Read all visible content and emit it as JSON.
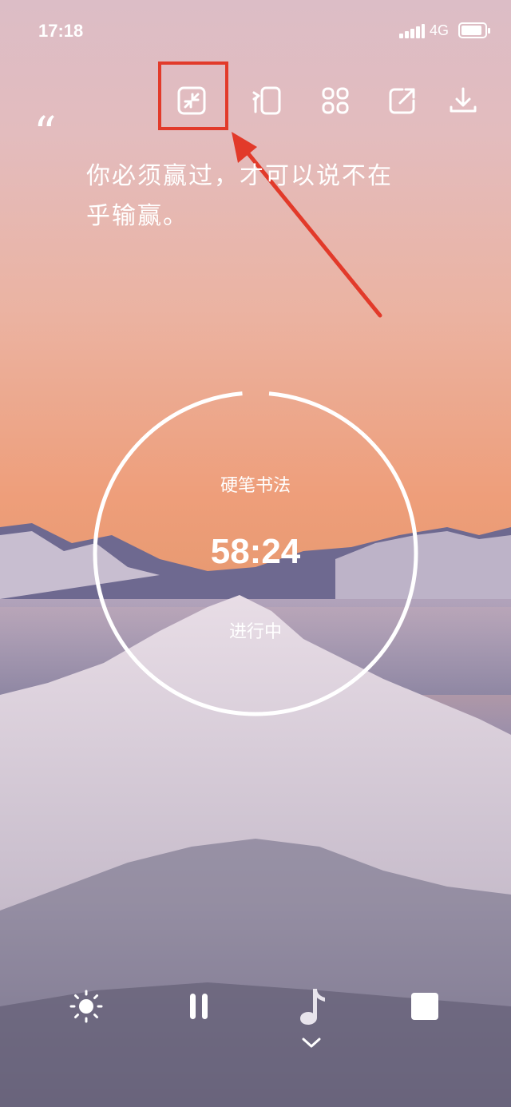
{
  "status_bar": {
    "time": "17:18",
    "network": "4G",
    "battery_level": 0.9
  },
  "toolbar": {
    "items": [
      {
        "icon": "minimize-screen-icon",
        "highlighted": true
      },
      {
        "icon": "rotate-screen-icon"
      },
      {
        "icon": "grid-apps-icon"
      },
      {
        "icon": "share-icon"
      },
      {
        "icon": "download-icon"
      }
    ]
  },
  "annotation": {
    "color": "#e23a2a"
  },
  "quote": {
    "mark": "“",
    "line1": "你必须赢过，才可以说不在",
    "line2": "乎输赢。"
  },
  "timer": {
    "task": "硬笔书法",
    "time": "58:24",
    "status": "进行中",
    "progress": 0.973
  },
  "bottom_bar": {
    "items": [
      {
        "icon": "brightness-icon"
      },
      {
        "icon": "pause-icon"
      },
      {
        "icon": "music-note-icon"
      },
      {
        "icon": "stop-icon"
      }
    ],
    "collapse_icon": "chevron-down-icon"
  }
}
